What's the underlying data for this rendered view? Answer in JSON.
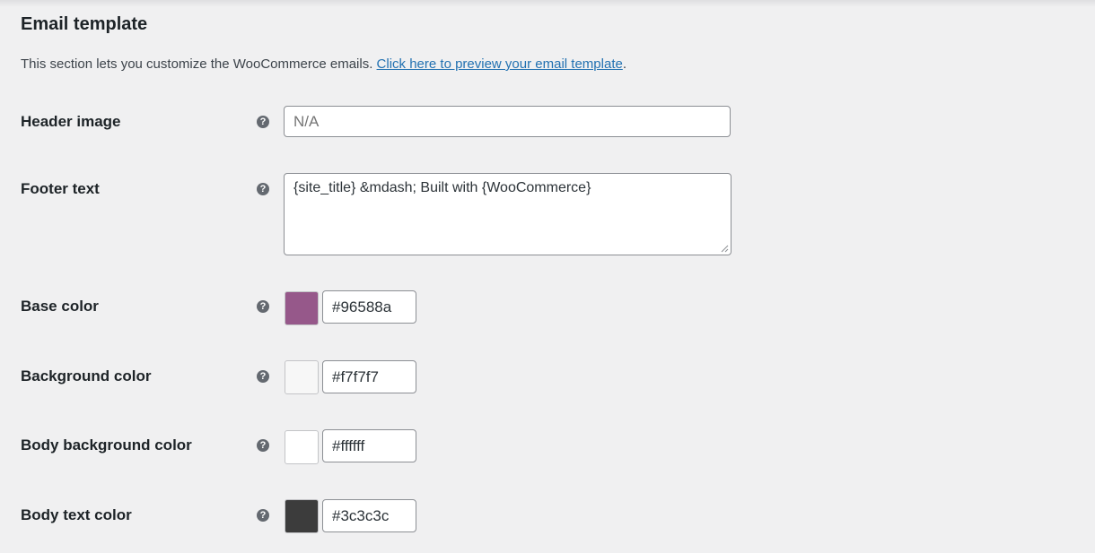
{
  "section": {
    "title": "Email template",
    "description": "This section lets you customize the WooCommerce emails. ",
    "preview_link": "Click here to preview your email template",
    "description_end": "."
  },
  "fields": {
    "header_image": {
      "label": "Header image",
      "help": "?",
      "placeholder": "N/A",
      "value": "N/A"
    },
    "footer_text": {
      "label": "Footer text",
      "help": "?",
      "value": "{site_title} &mdash; Built with {WooCommerce}"
    },
    "base_color": {
      "label": "Base color",
      "help": "?",
      "value": "#96588a",
      "swatch": "#96588a"
    },
    "background_color": {
      "label": "Background color",
      "help": "?",
      "value": "#f7f7f7",
      "swatch": "#f7f7f7"
    },
    "body_background_color": {
      "label": "Body background color",
      "help": "?",
      "value": "#ffffff",
      "swatch": "#ffffff"
    },
    "body_text_color": {
      "label": "Body text color",
      "help": "?",
      "value": "#3c3c3c",
      "swatch": "#3c3c3c"
    }
  },
  "theme": {
    "page_background": "#f0f0f1",
    "link_color": "#2271b1",
    "help_icon_color": "#646970"
  }
}
